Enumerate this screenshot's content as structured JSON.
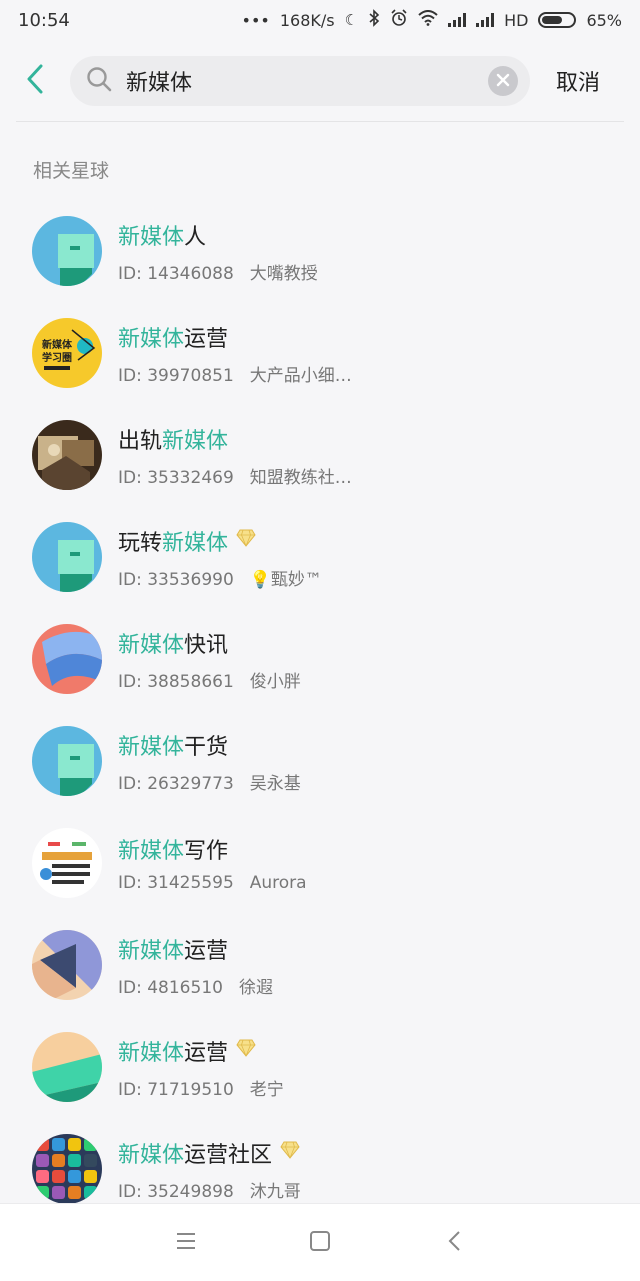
{
  "status_bar": {
    "time": "10:54",
    "dots": "•••",
    "net_speed": "168K/s",
    "hd": "HD",
    "battery": "65%",
    "battery_level": 0.65
  },
  "search": {
    "query": "新媒体",
    "placeholder": "",
    "cancel_label": "取消"
  },
  "section_title": "相关星球",
  "highlight_color": "#33b49b",
  "results": [
    {
      "prefix": "",
      "match": "新媒体",
      "suffix": "人",
      "id_label": "ID: 14346088",
      "owner": "大嘴教授",
      "premium": false,
      "avatar": "teal-card"
    },
    {
      "prefix": "",
      "match": "新媒体",
      "suffix": "运营",
      "id_label": "ID: 39970851",
      "owner": "大产品小细…",
      "premium": false,
      "avatar": "yellow-badge",
      "avatar_text": "新媒体学习圈"
    },
    {
      "prefix": "出轨",
      "match": "新媒体",
      "suffix": "",
      "id_label": "ID: 35332469",
      "owner": "知盟教练社…",
      "premium": false,
      "avatar": "photo"
    },
    {
      "prefix": "玩转",
      "match": "新媒体",
      "suffix": "",
      "id_label": "ID: 33536990",
      "owner": "💡甄妙™",
      "premium": true,
      "avatar": "teal-card"
    },
    {
      "prefix": "",
      "match": "新媒体",
      "suffix": "快讯",
      "id_label": "ID: 38858661",
      "owner": "俊小胖",
      "premium": false,
      "avatar": "blue-wave"
    },
    {
      "prefix": "",
      "match": "新媒体",
      "suffix": "干货",
      "id_label": "ID: 26329773",
      "owner": "吴永基",
      "premium": false,
      "avatar": "teal-card"
    },
    {
      "prefix": "",
      "match": "新媒体",
      "suffix": "写作",
      "id_label": "ID: 31425595",
      "owner": "Aurora",
      "premium": false,
      "avatar": "poster"
    },
    {
      "prefix": "",
      "match": "新媒体",
      "suffix": "运营",
      "id_label": "ID: 4816510",
      "owner": "徐遐",
      "premium": false,
      "avatar": "purple-triangle"
    },
    {
      "prefix": "",
      "match": "新媒体",
      "suffix": "运营",
      "id_label": "ID: 71719510",
      "owner": "老宁",
      "premium": true,
      "avatar": "peach-green"
    },
    {
      "prefix": "",
      "match": "新媒体",
      "suffix": "运营社区",
      "id_label": "ID: 35249898",
      "owner": "沐九哥",
      "premium": true,
      "avatar": "app-icons"
    }
  ],
  "icons": {
    "back": "chevron-left-icon",
    "search": "search-icon",
    "clear": "clear-icon",
    "premium": "diamond-icon",
    "nav_menu": "menu-icon",
    "nav_home": "home-square-icon",
    "nav_back": "back-triangle-icon"
  }
}
